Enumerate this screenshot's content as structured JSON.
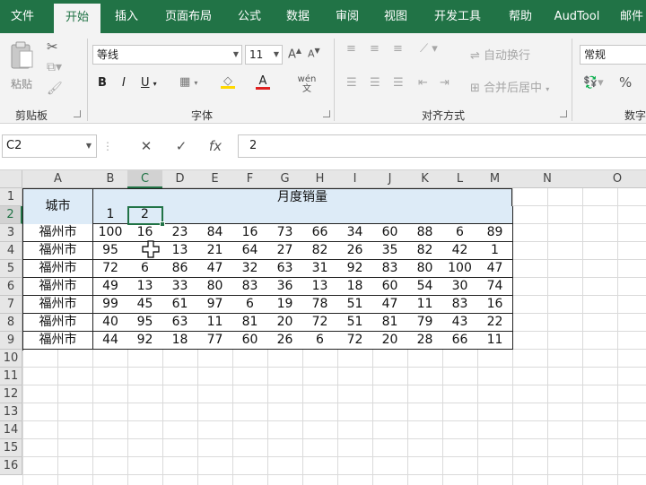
{
  "ribbon_tabs": [
    "文件",
    "开始",
    "插入",
    "页面布局",
    "公式",
    "数据",
    "审阅",
    "视图",
    "开发工具",
    "帮助",
    "AudTool",
    "邮件"
  ],
  "active_tab": "开始",
  "clipboard": {
    "paste_label": "粘贴",
    "group_label": "剪贴板"
  },
  "font": {
    "name": "等线",
    "size": "11",
    "group_label": "字体",
    "bold": "B",
    "italic": "I",
    "underline": "U",
    "phonetic": "wén 文",
    "font_color": "#e02020"
  },
  "alignment": {
    "wrap_text": "自动换行",
    "merge_center": "合并后居中",
    "group_label": "对齐方式"
  },
  "number": {
    "format": "常规",
    "percent": "%",
    "group_label": "数字"
  },
  "formula_bar": {
    "name_box": "C2",
    "cancel": "✕",
    "enter": "✓",
    "fx": "fx",
    "value": "2"
  },
  "sheet": {
    "columns": [
      "A",
      "B",
      "C",
      "D",
      "E",
      "F",
      "G",
      "H",
      "I",
      "J",
      "K",
      "L",
      "M",
      "N",
      "O"
    ],
    "rows": [
      "1",
      "2",
      "3",
      "4",
      "5",
      "6",
      "7",
      "8",
      "9",
      "10",
      "11",
      "12",
      "13",
      "14",
      "15",
      "16"
    ],
    "selected_cell": "C2",
    "header_city": "城市",
    "header_month_sales": "月度销量",
    "row2_values": [
      "1",
      "2",
      "",
      "",
      "",
      "",
      "",
      "",
      "",
      "",
      "",
      ""
    ],
    "data_rows": [
      {
        "city": "福州市",
        "values": [
          "100",
          "16",
          "23",
          "84",
          "16",
          "73",
          "66",
          "34",
          "60",
          "88",
          "6",
          "89"
        ]
      },
      {
        "city": "福州市",
        "values": [
          "95",
          "",
          "13",
          "21",
          "64",
          "27",
          "82",
          "26",
          "35",
          "82",
          "42",
          "1"
        ]
      },
      {
        "city": "福州市",
        "values": [
          "72",
          "6",
          "86",
          "47",
          "32",
          "63",
          "31",
          "92",
          "83",
          "80",
          "100",
          "47"
        ]
      },
      {
        "city": "福州市",
        "values": [
          "49",
          "13",
          "33",
          "80",
          "83",
          "36",
          "13",
          "18",
          "60",
          "54",
          "30",
          "74"
        ]
      },
      {
        "city": "福州市",
        "values": [
          "99",
          "45",
          "61",
          "97",
          "6",
          "19",
          "78",
          "51",
          "47",
          "11",
          "83",
          "16"
        ]
      },
      {
        "city": "福州市",
        "values": [
          "40",
          "95",
          "63",
          "11",
          "81",
          "20",
          "72",
          "51",
          "81",
          "79",
          "43",
          "22"
        ]
      },
      {
        "city": "福州市",
        "values": [
          "44",
          "92",
          "18",
          "77",
          "60",
          "26",
          "6",
          "72",
          "20",
          "28",
          "66",
          "11"
        ]
      }
    ]
  },
  "colors": {
    "accent": "#217346",
    "header_fill": "#ddebf7"
  }
}
